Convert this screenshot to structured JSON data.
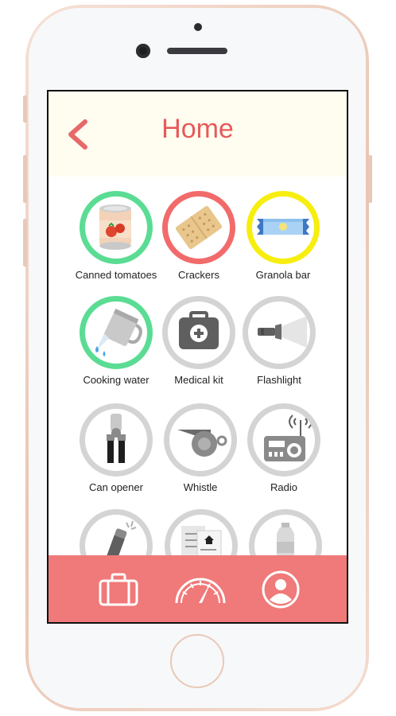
{
  "header": {
    "title": "Home",
    "back_icon": "chevron-left-icon"
  },
  "colors": {
    "accent": "#e65a5a",
    "tabbar": "#f07979",
    "header_bg": "#fffdf0",
    "status_green": "#5bdc94",
    "status_red": "#f26b6b",
    "status_yellow": "#f7ee0f",
    "status_none": "#d4d4d4"
  },
  "items": [
    {
      "label": "Canned tomatoes",
      "icon": "canned-tomatoes-icon",
      "status": "green"
    },
    {
      "label": "Crackers",
      "icon": "crackers-icon",
      "status": "red"
    },
    {
      "label": "Granola bar",
      "icon": "granola-bar-icon",
      "status": "yellow"
    },
    {
      "label": "Cooking water",
      "icon": "cooking-water-icon",
      "status": "green"
    },
    {
      "label": "Medical kit",
      "icon": "medical-kit-icon",
      "status": "none"
    },
    {
      "label": "Flashlight",
      "icon": "flashlight-icon",
      "status": "none"
    },
    {
      "label": "Can opener",
      "icon": "can-opener-icon",
      "status": "none"
    },
    {
      "label": "Whistle",
      "icon": "whistle-icon",
      "status": "none"
    },
    {
      "label": "Radio",
      "icon": "radio-icon",
      "status": "none"
    },
    {
      "label": "",
      "icon": "glow-stick-icon",
      "status": "none"
    },
    {
      "label": "",
      "icon": "documents-icon",
      "status": "none"
    },
    {
      "label": "",
      "icon": "water-bottle-icon",
      "status": "none"
    }
  ],
  "tabs": [
    {
      "name": "kit",
      "icon": "briefcase-icon"
    },
    {
      "name": "status",
      "icon": "gauge-icon"
    },
    {
      "name": "profile",
      "icon": "user-icon"
    }
  ]
}
